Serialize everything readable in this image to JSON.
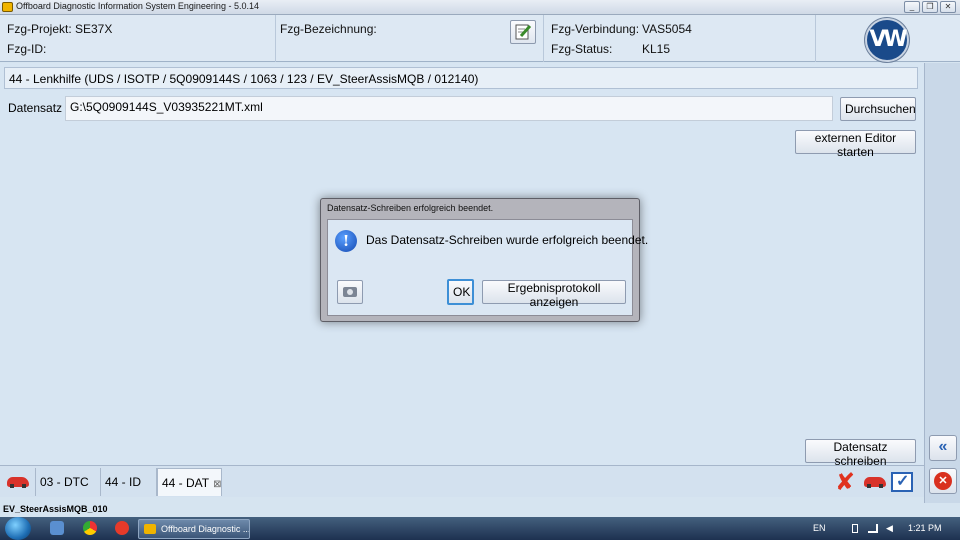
{
  "window": {
    "title": "Offboard Diagnostic Information System Engineering - 5.0.14",
    "controls": {
      "minimize": "_",
      "restore": "❐",
      "close": "✕"
    }
  },
  "header": {
    "projekt_label": "Fzg-Projekt:",
    "projekt_value": "SE37X",
    "id_label": "Fzg-ID:",
    "id_value": "",
    "bezeichnung_label": "Fzg-Bezeichnung:",
    "verbindung_label": "Fzg-Verbindung:",
    "verbindung_value": "VAS5054",
    "status_label": "Fzg-Status:",
    "status_value": "KL15",
    "logo_text": "VW"
  },
  "main": {
    "ecu_line": "44 - Lenkhilfe  (UDS / ISOTP / 5Q0909144S  / 1063 / 123 / EV_SteerAssisMQB / 012140)",
    "datensatz_label": "Datensatz",
    "datensatz_value": "G:\\5Q0909144S_V03935221MT.xml",
    "browse_button": "Durchsuchen",
    "editor_button": "externen Editor starten",
    "write_button": "Datensatz schreiben"
  },
  "dialog": {
    "title": "Datensatz-Schreiben erfolgreich beendet.",
    "message": "Das Datensatz-Schreiben wurde erfolgreich beendet.",
    "ok_button": "OK",
    "protocol_button": "Ergebnisprotokoll anzeigen"
  },
  "tabs": [
    {
      "label": "03 - DTC"
    },
    {
      "label": "44 - ID"
    },
    {
      "label": "44 - DAT",
      "close": "⊠"
    }
  ],
  "sidebar": {
    "collapse_glyph": "«",
    "close_glyph": "✕"
  },
  "status_line": "EV_SteerAssisMQB_010",
  "taskbar": {
    "task_label": "Offboard Diagnostic ...",
    "language": "EN",
    "clock": "1:21 PM"
  },
  "colors": {
    "background": "#d6e4f0",
    "accent_blue": "#1448b0",
    "error_red": "#e0321f"
  }
}
